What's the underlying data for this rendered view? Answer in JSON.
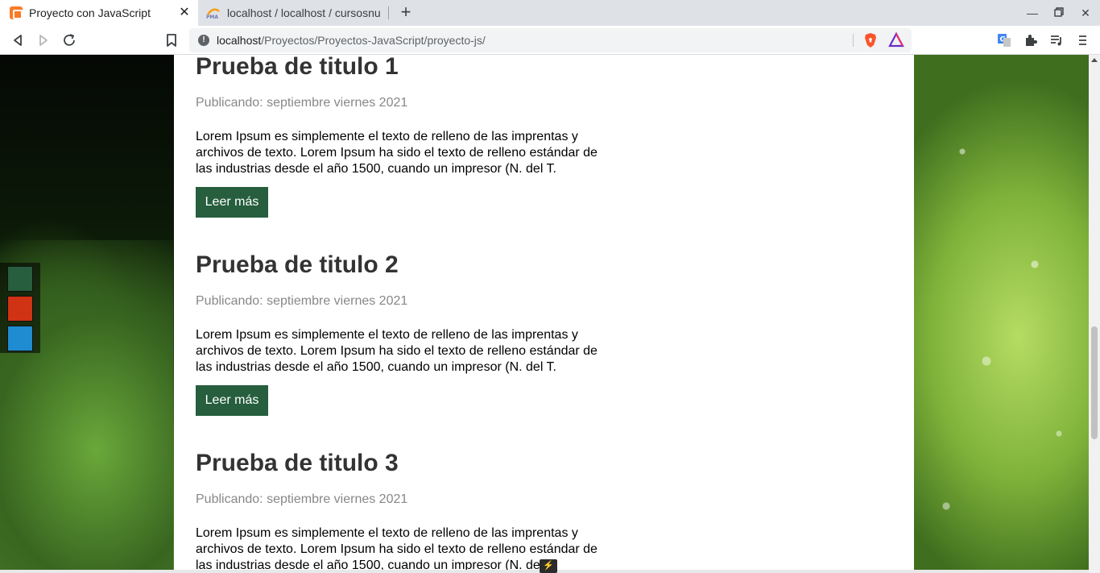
{
  "browser": {
    "tabs": [
      {
        "title": "Proyecto con JavaScript",
        "active": true,
        "favicon": "xampp-icon"
      },
      {
        "title": "localhost / localhost / cursosnu",
        "active": false,
        "favicon": "phpmyadmin-icon"
      }
    ],
    "url": {
      "host": "localhost",
      "path": "/Proyectos/Proyectos-JavaScript/proyecto-js/"
    }
  },
  "page": {
    "posts": [
      {
        "title": "Prueba de titulo 1",
        "date": "Publicando: septiembre viernes 2021",
        "body": "Lorem Ipsum es simplemente el texto de relleno de las imprentas y archivos de texto. Lorem Ipsum ha sido el texto de relleno estándar de las industrias desde el año 1500, cuando un impresor (N. del T.",
        "button": "Leer más"
      },
      {
        "title": "Prueba de titulo 2",
        "date": "Publicando: septiembre viernes 2021",
        "body": "Lorem Ipsum es simplemente el texto de relleno de las imprentas y archivos de texto. Lorem Ipsum ha sido el texto de relleno estándar de las industrias desde el año 1500, cuando un impresor (N. del T.",
        "button": "Leer más"
      },
      {
        "title": "Prueba de titulo 3",
        "date": "Publicando: septiembre viernes 2021",
        "body": "Lorem Ipsum es simplemente el texto de relleno de las imprentas y archivos de texto. Lorem Ipsum ha sido el texto de relleno estándar de las industrias desde el año 1500, cuando un impresor (N. del T."
      }
    ],
    "theme_swatches": [
      {
        "name": "green",
        "color": "#265e3e"
      },
      {
        "name": "red",
        "color": "#d03214"
      },
      {
        "name": "blue",
        "color": "#1f8bd0"
      }
    ]
  }
}
